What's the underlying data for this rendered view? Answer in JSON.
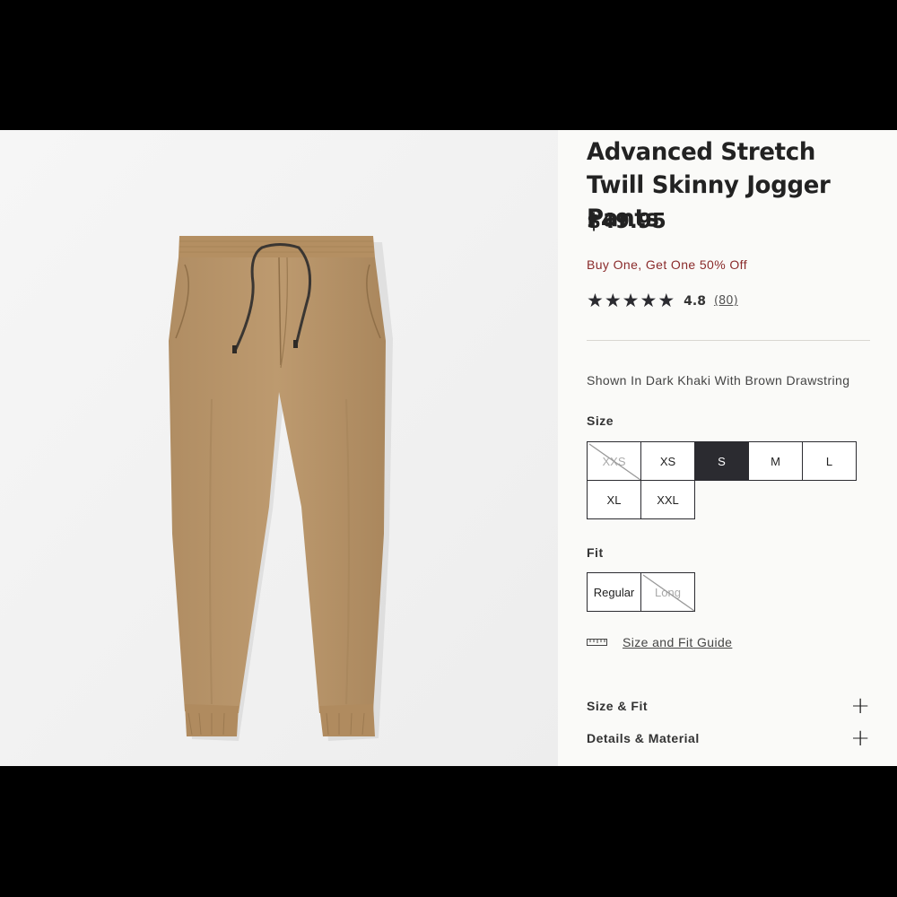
{
  "product": {
    "title": "Advanced Stretch Twill Skinny Jogger Pants",
    "price": "$49.95",
    "promo": "Buy One, Get One 50% Off",
    "rating": {
      "stars": 4.8,
      "value": "4.8",
      "reviews": "(80)"
    },
    "color_description": "Shown In Dark Khaki With Brown Drawstring",
    "colors": {
      "pants": "#b8946a",
      "drawstring": "#3a3632",
      "accent_dark": "#2b2b30",
      "promo": "#8a2b2b"
    }
  },
  "size": {
    "label": "Size",
    "options": [
      {
        "label": "XXS",
        "state": "unavailable"
      },
      {
        "label": "XS",
        "state": "available"
      },
      {
        "label": "S",
        "state": "selected"
      },
      {
        "label": "M",
        "state": "available"
      },
      {
        "label": "L",
        "state": "available"
      },
      {
        "label": "XL",
        "state": "available"
      },
      {
        "label": "XXL",
        "state": "available"
      }
    ]
  },
  "fit": {
    "label": "Fit",
    "options": [
      {
        "label": "Regular",
        "state": "available"
      },
      {
        "label": "Long",
        "state": "unavailable"
      }
    ]
  },
  "guide": {
    "icon": "ruler-icon",
    "link": "Size and Fit Guide"
  },
  "accordions": [
    {
      "label": "Size & Fit",
      "icon": "plus-icon"
    },
    {
      "label": "Details & Material",
      "icon": "plus-icon"
    }
  ]
}
